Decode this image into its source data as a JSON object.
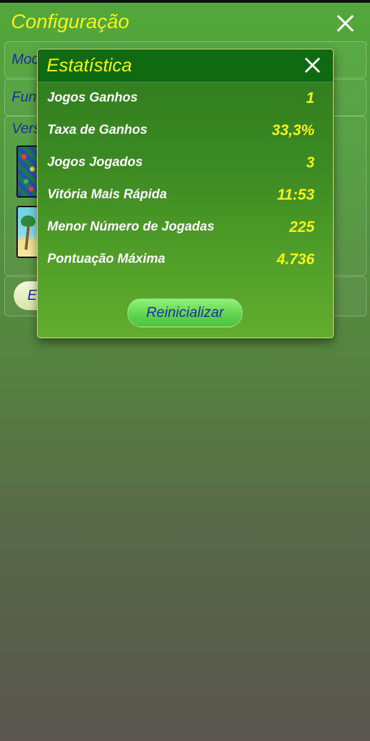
{
  "settings": {
    "title": "Configuração",
    "panels": [
      {
        "label": "Moc"
      },
      {
        "label": "Fun"
      },
      {
        "label": "Vers"
      }
    ],
    "button_label": "E"
  },
  "stats_dialog": {
    "title": "Estatística",
    "rows": [
      {
        "label": "Jogos Ganhos",
        "value": "1"
      },
      {
        "label": "Taxa de Ganhos",
        "value": "33,3%"
      },
      {
        "label": "Jogos Jogados",
        "value": "3"
      },
      {
        "label": "Vitória Mais Rápida",
        "value": "11:53"
      },
      {
        "label": "Menor Número de Jogadas",
        "value": "225"
      },
      {
        "label": "Pontuação Máxima",
        "value": "4.736"
      }
    ],
    "reset_label": "Reinicializar"
  },
  "icons": {
    "close": "close-icon"
  },
  "colors": {
    "title_yellow": "#f6f21b",
    "value_yellow": "#f6f21b",
    "header_green": "#0e6b12",
    "button_green": "#62d54f",
    "label_blue": "#1a2e9a"
  }
}
